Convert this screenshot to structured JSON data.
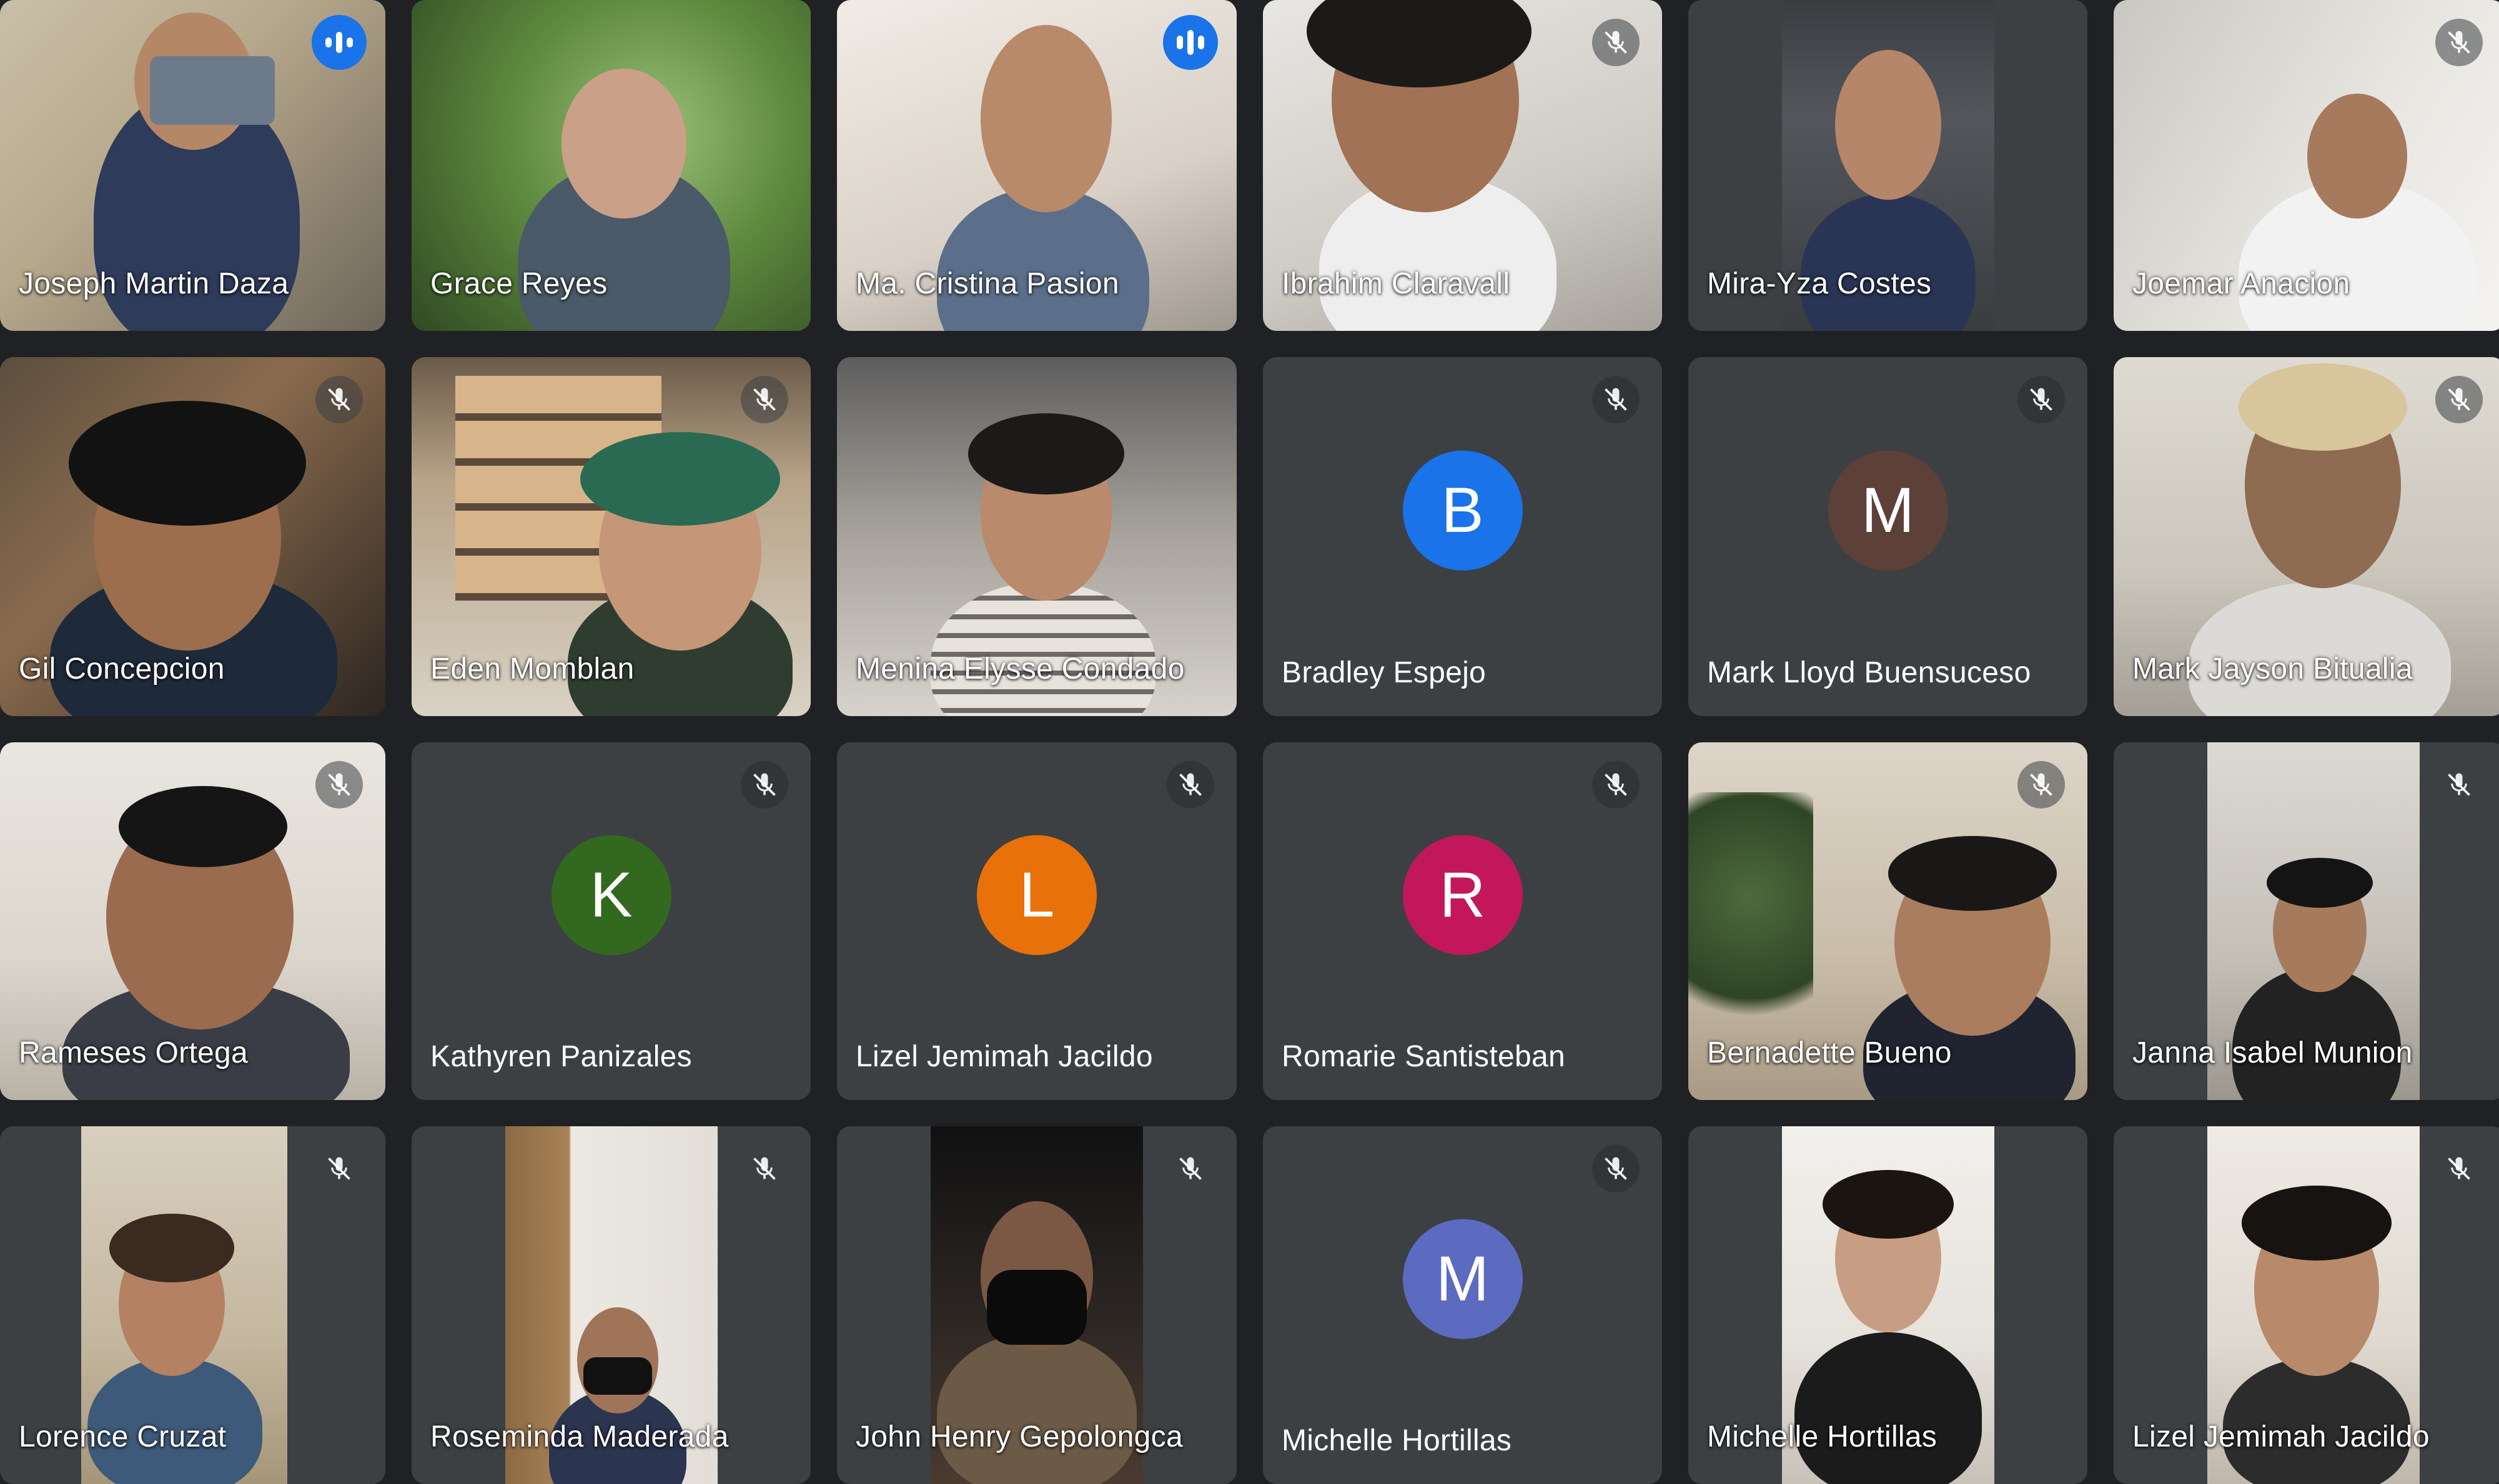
{
  "meeting": {
    "accent_color": "#8ab4f8",
    "speaking_badge_color": "#1a73e8",
    "muted_icon": "mic-off-icon",
    "speaking_icon": "audio-level-icon",
    "tiles": [
      {
        "name": "Joseph Martin Daza",
        "type": "video",
        "status": "speaking"
      },
      {
        "name": "Grace Reyes",
        "type": "video",
        "status": "none"
      },
      {
        "name": "Ma. Cristina Pasion",
        "type": "video",
        "status": "speaking",
        "highlighted": true
      },
      {
        "name": "Ibrahim Claravall",
        "type": "video",
        "status": "muted"
      },
      {
        "name": "Mira-Yza Costes",
        "type": "video",
        "status": "none"
      },
      {
        "name": "Joemar Anacion",
        "type": "video",
        "status": "muted"
      },
      {
        "name": "Gil Concepcion",
        "type": "video",
        "status": "muted"
      },
      {
        "name": "Eden Momblan",
        "type": "video",
        "status": "muted"
      },
      {
        "name": "Menina Elysse Condado",
        "type": "video",
        "status": "none"
      },
      {
        "name": "Bradley Espejo",
        "type": "avatar",
        "initial": "B",
        "avatar_color": "#1a73e8",
        "status": "muted"
      },
      {
        "name": "Mark Lloyd Buensuceso",
        "type": "avatar",
        "initial": "M",
        "avatar_color": "#5d4037",
        "status": "muted"
      },
      {
        "name": "Mark Jayson Bitualia",
        "type": "video",
        "status": "muted"
      },
      {
        "name": "Rameses Ortega",
        "type": "video",
        "status": "muted"
      },
      {
        "name": "Kathyren Panizales",
        "type": "avatar",
        "initial": "K",
        "avatar_color": "#33691e",
        "status": "muted"
      },
      {
        "name": "Lizel Jemimah Jacildo",
        "type": "avatar",
        "initial": "L",
        "avatar_color": "#e8710a",
        "status": "muted"
      },
      {
        "name": "Romarie Santisteban",
        "type": "avatar",
        "initial": "R",
        "avatar_color": "#c2185b",
        "status": "muted"
      },
      {
        "name": "Bernadette Bueno",
        "type": "video",
        "status": "muted"
      },
      {
        "name": "Janna Isabel Munion",
        "type": "video",
        "status": "muted"
      },
      {
        "name": "Lorence Cruzat",
        "type": "video",
        "status": "muted"
      },
      {
        "name": "Roseminda Maderada",
        "type": "video",
        "status": "muted"
      },
      {
        "name": "John Henry Gepolongca",
        "type": "video",
        "status": "muted"
      },
      {
        "name": "Michelle Hortillas",
        "type": "avatar",
        "initial": "M",
        "avatar_color": "#5c6bc0",
        "status": "muted"
      },
      {
        "name": "Michelle Hortillas",
        "type": "video",
        "status": "none"
      },
      {
        "name": "Lizel Jemimah Jacildo",
        "type": "video",
        "status": "muted"
      }
    ]
  }
}
